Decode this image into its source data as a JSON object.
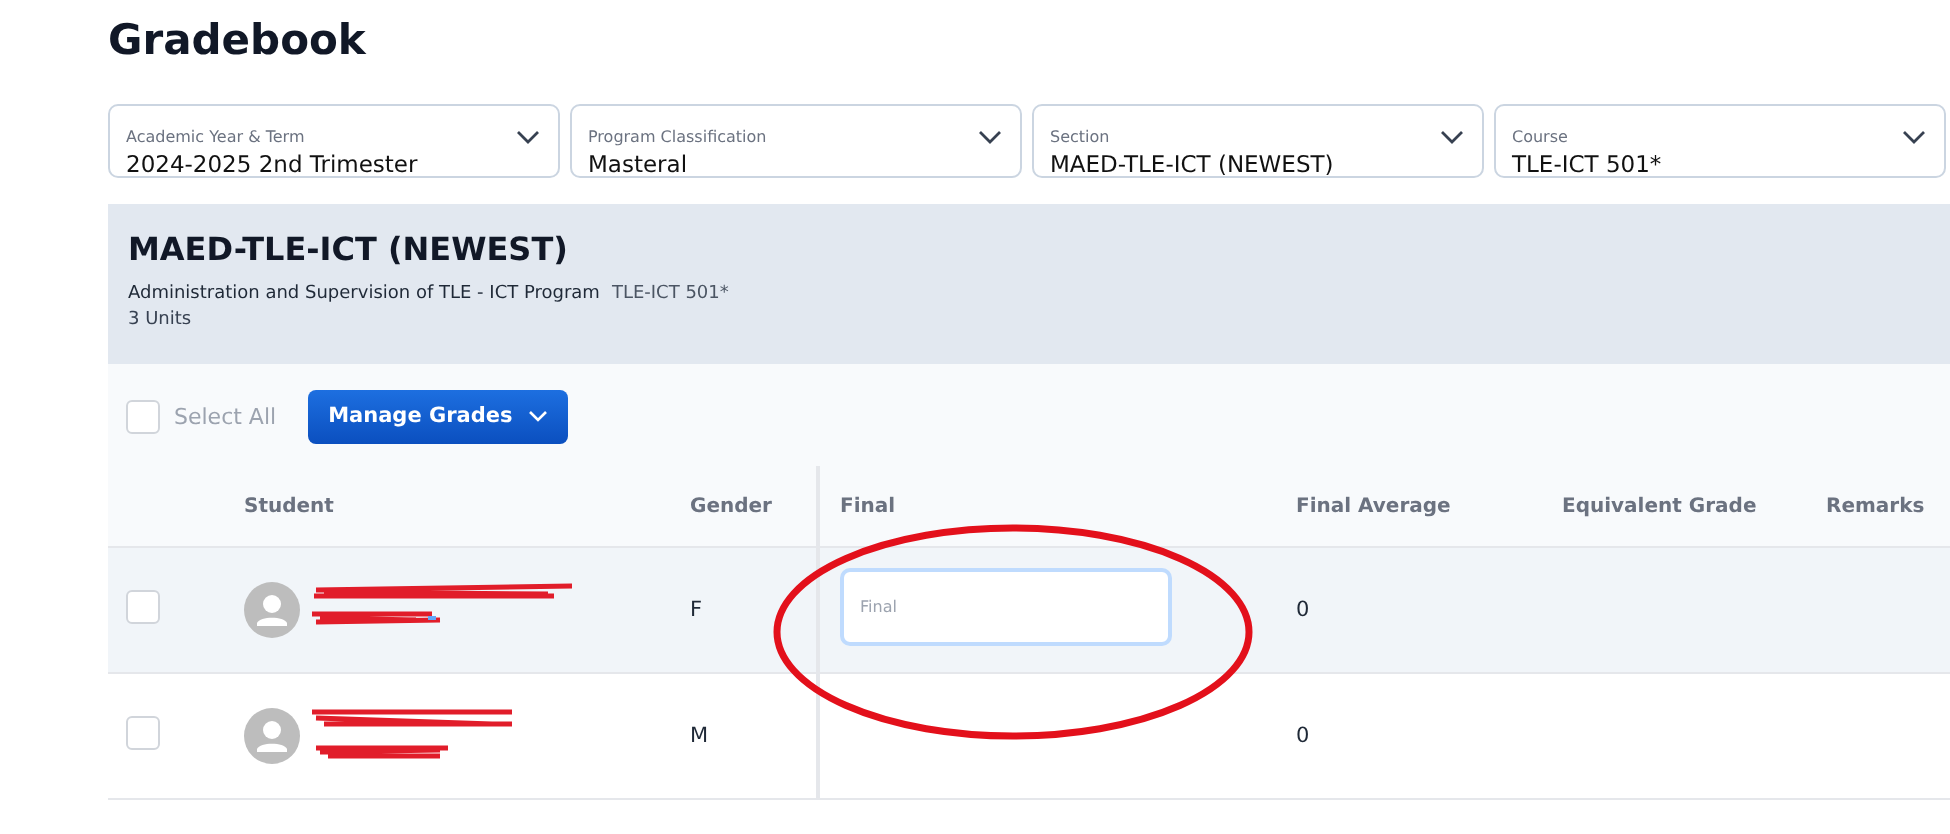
{
  "page": {
    "title": "Gradebook"
  },
  "filters": [
    {
      "label": "Academic Year & Term",
      "value": "2024-2025 2nd Trimester"
    },
    {
      "label": "Program Classification",
      "value": "Masteral"
    },
    {
      "label": "Section",
      "value": "MAED-TLE-ICT (NEWEST)"
    },
    {
      "label": "Course",
      "value": "TLE-ICT 501*"
    }
  ],
  "course": {
    "section": "MAED-TLE-ICT (NEWEST)",
    "description": "Administration and Supervision of TLE - ICT Program",
    "code": "TLE-ICT 501*",
    "units": "3 Units"
  },
  "toolbar": {
    "select_all": {
      "label": "Select All",
      "checked": false
    },
    "manage_button": "Manage Grades"
  },
  "table": {
    "columns": [
      "Student",
      "Gender",
      "Final",
      "Final Average",
      "Equivalent Grade",
      "Remarks"
    ],
    "rows": [
      {
        "checked": false,
        "hovered": true,
        "gender": "F",
        "final": {
          "placeholder": "Final"
        },
        "final_average": "0"
      },
      {
        "checked": false,
        "hovered": false,
        "gender": "M",
        "final_average": "0"
      }
    ]
  }
}
